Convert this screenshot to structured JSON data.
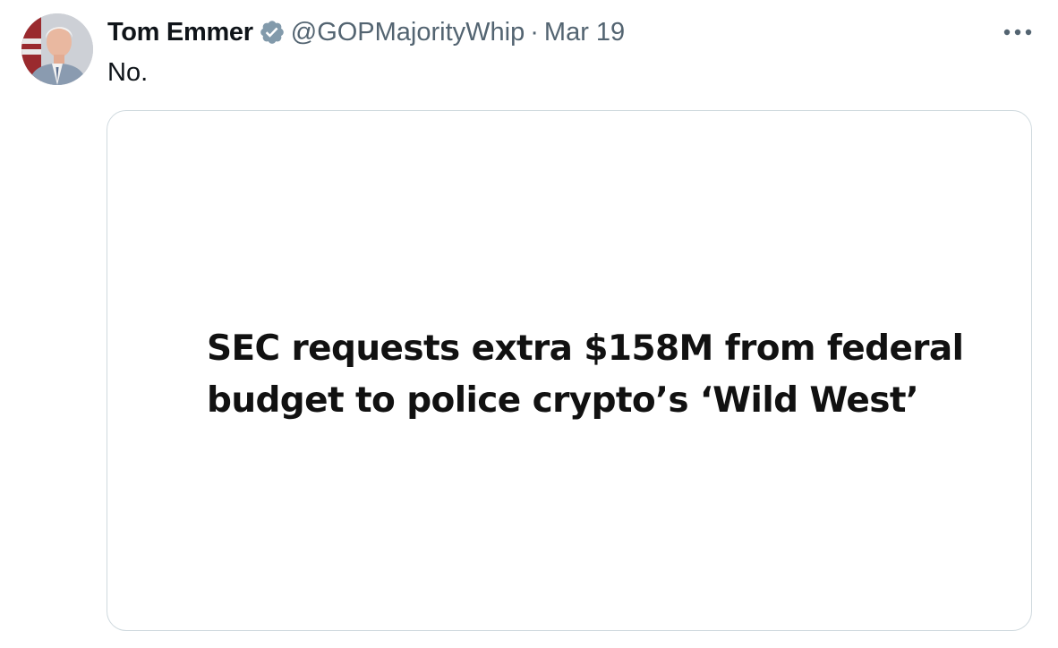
{
  "tweet": {
    "author_name": "Tom Emmer",
    "verified_badge_icon": "verified-badge-icon",
    "handle": "@GOPMajorityWhip",
    "separator": "·",
    "date": "Mar 19",
    "text": "No.",
    "more_icon": "more-options-icon",
    "media": {
      "headline": "SEC requests extra $158M from federal\nbudget to police crypto’s ‘Wild West’"
    }
  },
  "colors": {
    "primary_text": "#0f1419",
    "secondary_text": "#536471",
    "badge": "#829aab",
    "card_border": "#cfd9de"
  }
}
